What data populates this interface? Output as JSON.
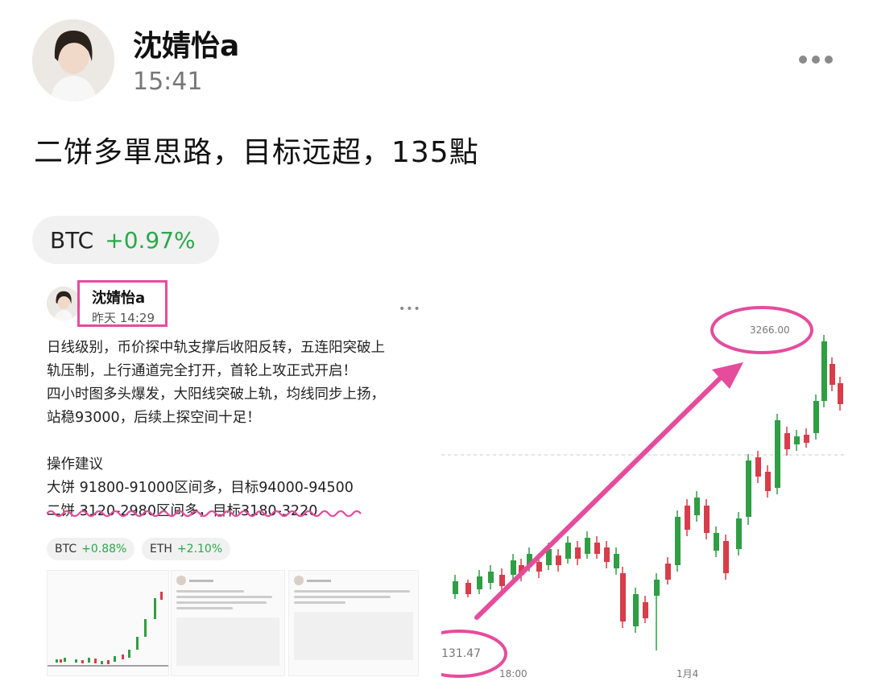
{
  "post": {
    "author": "沈婧怡a",
    "time": "15:41",
    "content": "二饼多單思路，目标远超，135點",
    "ticker": {
      "symbol": "BTC",
      "change": "+0.97%"
    }
  },
  "embedded_post": {
    "author": "沈婧怡a",
    "time": "昨天 14:29",
    "lines": [
      "日线级别，币价探中轨支撑后收阳反转，五连阳突破上",
      "轨压制，上行通道完全打开，首轮上攻正式开启！",
      "四小时图多头爆发，大阳线突破上轨，均线同步上扬，",
      "站稳93000，后续上探空间十足！",
      "",
      "操作建议",
      "大饼   91800-91000区间多，目标94000-94500",
      "二饼   3120-2980区间多，目标3180-3220"
    ],
    "tags": [
      {
        "symbol": "BTC",
        "change": "+0.88%"
      },
      {
        "symbol": "ETH",
        "change": "+2.10%"
      }
    ]
  },
  "chart_data": {
    "type": "candlestick",
    "price_label_high": "3266.00",
    "price_label_low": "131.47",
    "x_tick_labels": [
      "18:00",
      "1月4"
    ],
    "colors": {
      "up": "#2f9e44",
      "down": "#d93c4a",
      "annotation": "#e64c9c"
    }
  }
}
